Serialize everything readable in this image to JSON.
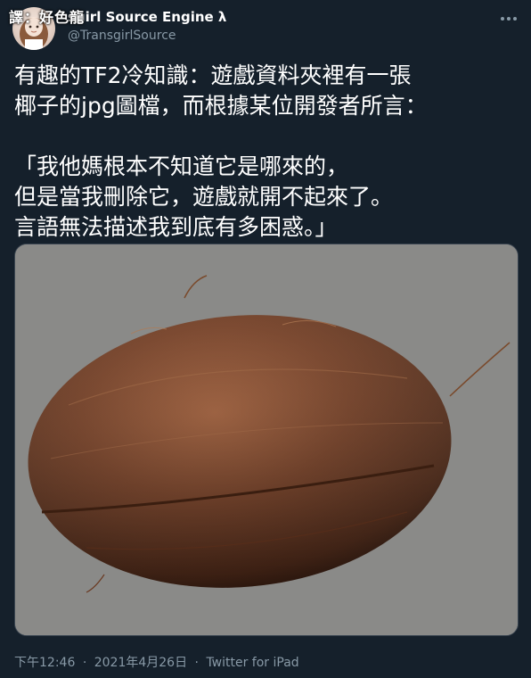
{
  "watermark": "譯：好色龍",
  "author": {
    "display_name": "Transgirl Source Engine λ",
    "visible_name": "sgirl Source Engine λ",
    "handle": "@TransgirlSource"
  },
  "tweet": {
    "text": "有趣的TF2冷知識：遊戲資料夾裡有一張\n椰子的jpg圖檔，而根據某位開發者所言：\n\n「我他媽根本不知道它是哪來的，\n但是當我刪除它，遊戲就開不起來了。\n言語無法描述我到底有多困惑。」",
    "media_alt": "coconut"
  },
  "footer": {
    "time": "下午12:46",
    "separator": "·",
    "date": "2021年4月26日",
    "source": "Twitter for iPad"
  },
  "icons": {
    "more": "more-options-icon"
  },
  "colors": {
    "background": "#15202b",
    "text": "#ffffff",
    "secondary": "#8899a6",
    "image_background": "#8a8a88",
    "coconut": "#6b3a22"
  }
}
